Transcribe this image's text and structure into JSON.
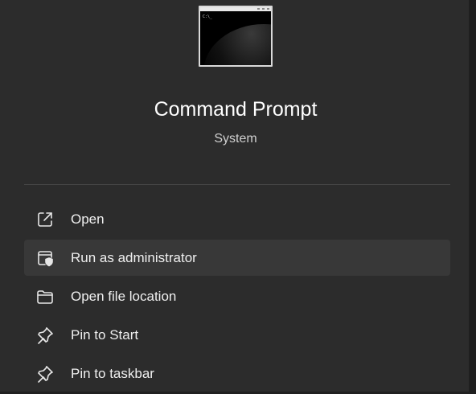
{
  "app": {
    "name": "Command Prompt",
    "type": "System",
    "icon": "command-prompt-icon",
    "icon_prompt_text": "C:\\_"
  },
  "menu": {
    "items": [
      {
        "label": "Open",
        "icon": "open-external-icon"
      },
      {
        "label": "Run as administrator",
        "icon": "shield-window-icon",
        "highlighted": true
      },
      {
        "label": "Open file location",
        "icon": "folder-icon"
      },
      {
        "label": "Pin to Start",
        "icon": "pin-icon"
      },
      {
        "label": "Pin to taskbar",
        "icon": "pin-icon"
      }
    ]
  },
  "colors": {
    "panel_bg": "#2c2c2c",
    "hover_bg": "#383838",
    "text": "#ffffff",
    "subtext": "#d0d0d0"
  }
}
